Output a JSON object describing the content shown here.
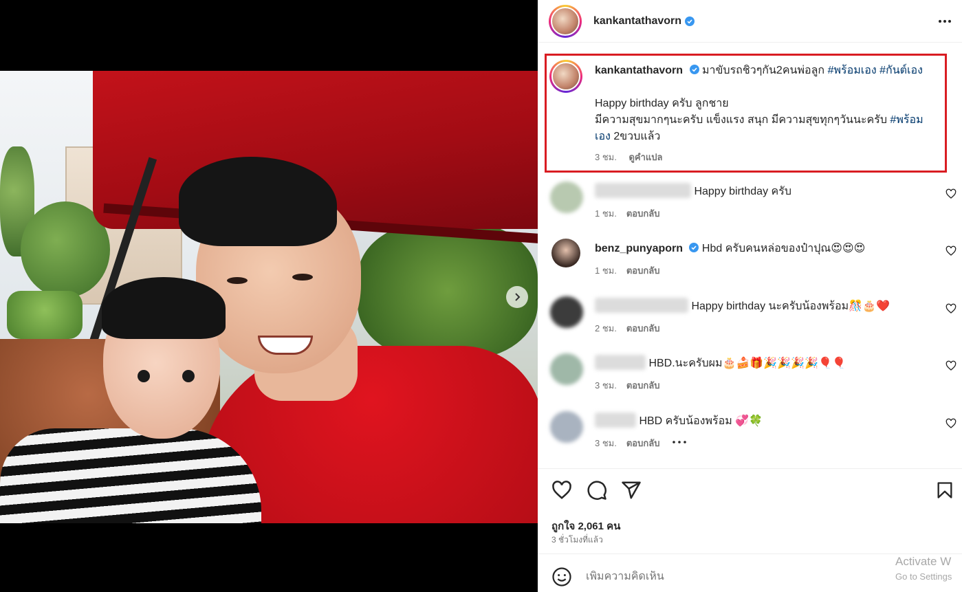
{
  "post": {
    "username": "kankantathavorn",
    "caption": {
      "line1_text": "มาขับรถชิวๆกัน2คนพ่อลูก ",
      "line1_tags": [
        "#พร้อมเอง",
        "#กันต์เอง"
      ],
      "line2": "Happy birthday ครับ ลูกชาย",
      "line3_text": "มีความสุขมากๆนะครับ แข็งแรง สนุก มีความสุขทุกๆวันนะครับ ",
      "line3_tag": "#พร้อม",
      "line4_tag": "เอง",
      "line4_text": " 2ขวบแล้ว",
      "time": "3 ชม.",
      "translate": "ดูคำแปล"
    }
  },
  "comments": [
    {
      "name": "",
      "text": "Happy birthday ครับ",
      "time": "1 ชม.",
      "reply": "ตอบกลับ",
      "avatar_color": "#b8c9b0"
    },
    {
      "name": "benz_punyaporn",
      "text": "Hbd ครับคนหล่อของป๋าปุณ😍😍😍",
      "time": "1 ชม.",
      "reply": "ตอบกลับ",
      "avatar_color": "#3a2a24"
    },
    {
      "name": "",
      "text": "Happy birthday นะครับน้องพร้อม🎊🎂❤️",
      "time": "2 ชม.",
      "reply": "ตอบกลับ",
      "avatar_color": "#3c3c3c"
    },
    {
      "name": "",
      "text": "HBD.นะครับผม🎂🍰🎁🎉🎉🎉🎉🎈🎈",
      "time": "3 ชม.",
      "reply": "ตอบกลับ",
      "avatar_color": "#9fb8a8"
    },
    {
      "name": "",
      "text": "HBD ครับน้องพร้อม 💞🍀",
      "time": "3 ชม.",
      "reply": "ตอบกลับ",
      "avatar_color": "#a9b3c0"
    }
  ],
  "stats": {
    "likes": "ถูกใจ 2,061 คน",
    "posted": "3 ชั่วโมงที่แล้ว"
  },
  "composer": {
    "placeholder": "เพิ่มความคิดเห็น"
  },
  "watermark": {
    "line1": "Activate W",
    "line2": "Go to Settings"
  },
  "icons": {
    "verified": "verified-badge-icon",
    "more": "more-options-icon",
    "like": "heart-icon",
    "comment": "comment-icon",
    "share": "send-icon",
    "save": "bookmark-icon",
    "emoji": "emoji-icon",
    "next": "chevron-right-icon"
  },
  "colors": {
    "verified": "#3897f0",
    "highlight_border": "#d91c22",
    "hashtag": "#00376b"
  }
}
